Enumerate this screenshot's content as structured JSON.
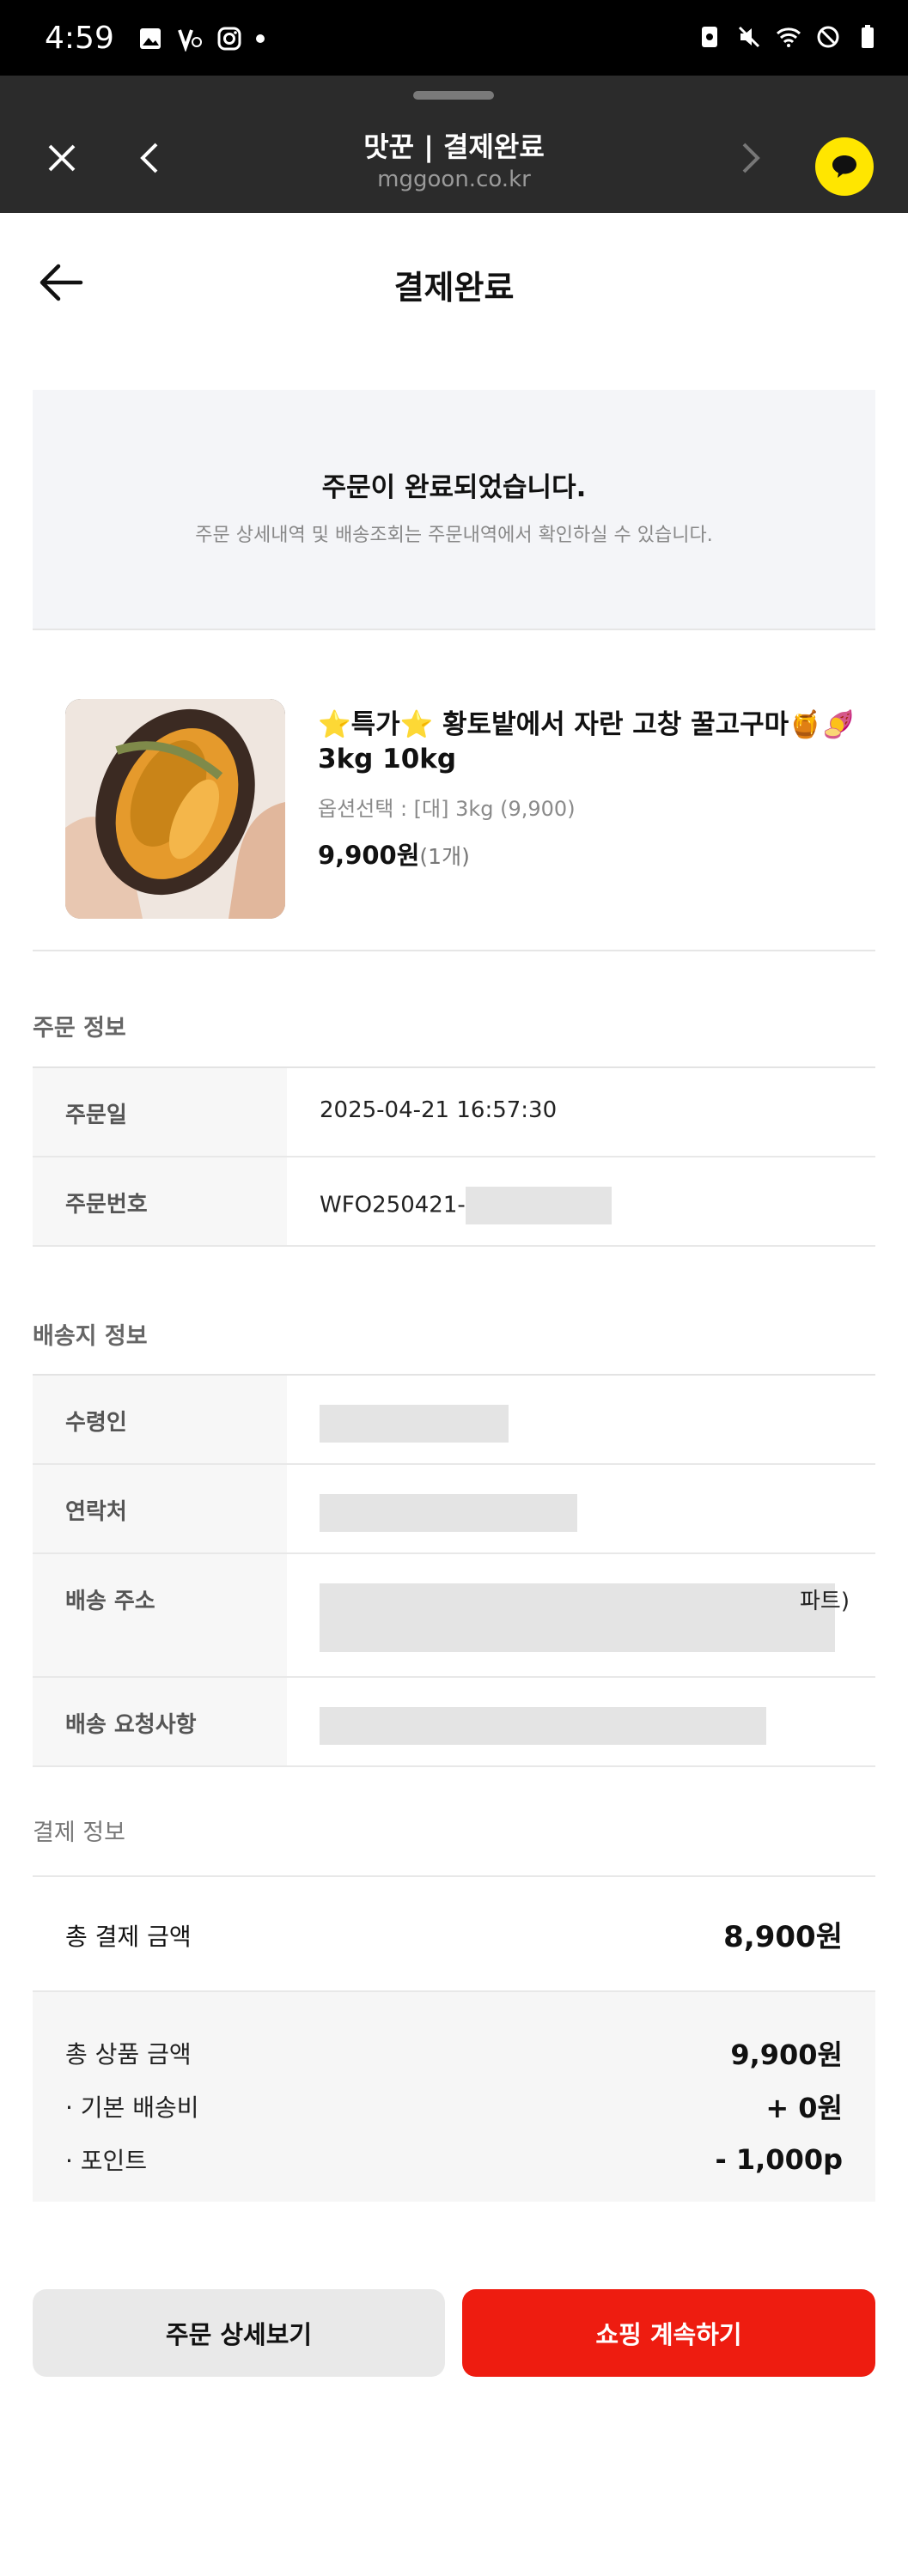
{
  "status_bar": {
    "time": "4:59",
    "left_icons": [
      "gallery-icon",
      "v-app-icon",
      "instagram-icon",
      "notification-dot"
    ],
    "right_icons": [
      "nfc-icon",
      "mute-icon",
      "wifi-icon",
      "dnd-icon",
      "battery-icon"
    ]
  },
  "browser": {
    "title": "맛꾼 | 결제완료",
    "url": "mggoon.co.kr"
  },
  "page": {
    "title": "결제완료"
  },
  "completion": {
    "heading": "주문이 완료되었습니다.",
    "subtext": "주문 상세내역 및 배송조회는 주문내역에서 확인하실 수 있습니다."
  },
  "product": {
    "name": "⭐특가⭐ 황토밭에서 자란 고창 꿀고구마🍯🍠 3kg 10kg",
    "option": "옵션선택 : [대] 3kg (9,900)",
    "price": "9,900원",
    "qty": "(1개)"
  },
  "order_info": {
    "label": "주문 정보",
    "rows": [
      {
        "key": "주문일",
        "value": "2025-04-21 16:57:30"
      },
      {
        "key": "주문번호",
        "value": "WFO250421-"
      }
    ]
  },
  "shipping_info": {
    "label": "배송지 정보",
    "rows": [
      {
        "key": "수령인",
        "value": ""
      },
      {
        "key": "연락처",
        "value": ""
      },
      {
        "key": "배송 주소",
        "value": "파트)"
      },
      {
        "key": "배송 요청사항",
        "value": ""
      }
    ]
  },
  "payment": {
    "label": "결제 정보",
    "total_label": "총 결제 금액",
    "total_value": "8,900원",
    "lines": [
      {
        "key": "총 상품 금액",
        "value": "9,900원"
      },
      {
        "key": "· 기본 배송비",
        "value": "+ 0원"
      },
      {
        "key": "· 포인트",
        "value": "- 1,000p"
      }
    ]
  },
  "buttons": {
    "detail": "주문 상세보기",
    "continue_shopping": "쇼핑 계속하기"
  },
  "colors": {
    "primary_red": "#ee1c10",
    "chat_yellow": "#ffe600",
    "browser_dark": "#2b2b2b"
  }
}
